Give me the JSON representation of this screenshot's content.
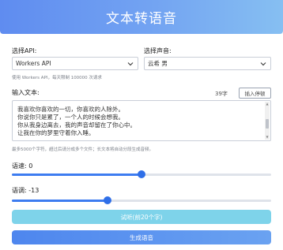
{
  "header": {
    "title": "文本转语音"
  },
  "api": {
    "label": "选择API:",
    "selected": "Workers API",
    "hint": "使用 Workers API，每天限制 100000 次请求"
  },
  "voice": {
    "label": "选择声音:",
    "selected": "云希 男"
  },
  "text": {
    "label": "输入文本:",
    "char_count": "39字",
    "insert_button": "插入停顿",
    "lines": [
      "我喜欢你喜欢的一切，你喜欢的人除外。",
      "你说你只是累了，一个人的时候会想我。",
      "你从我身边离去，我的声音却留在了你心中。",
      "让我在你的梦里守着你入睡。"
    ],
    "hint": "最多5000个字符，超过后请分成多个文件；长文本将自动分段生成音频。"
  },
  "speed": {
    "label": "语速: 0",
    "value": 0,
    "min": -50,
    "max": 50
  },
  "pitch": {
    "label": "语调: -13",
    "value": -13,
    "min": -50,
    "max": 50
  },
  "buttons": {
    "preview": "试听(前20个字)",
    "generate": "生成语音"
  },
  "colors": {
    "accent": "#3d7cf0",
    "preview": "#7ed3ea"
  }
}
